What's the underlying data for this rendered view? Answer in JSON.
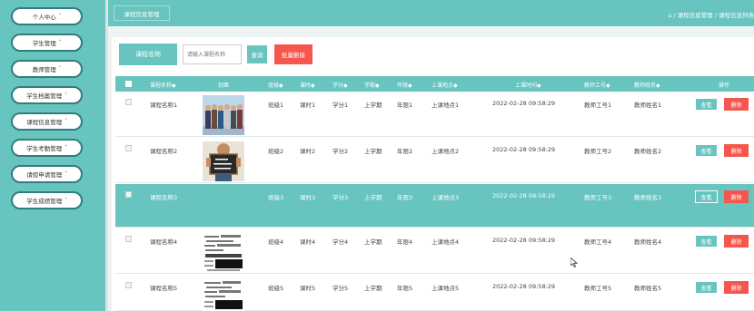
{
  "sidebar": {
    "items": [
      {
        "label": "个人中心"
      },
      {
        "label": "学生管理"
      },
      {
        "label": "教师管理"
      },
      {
        "label": "学生档案管理"
      },
      {
        "label": "课程信息管理"
      },
      {
        "label": "学生考勤管理"
      },
      {
        "label": "请假申请管理"
      },
      {
        "label": "学生成绩管理"
      }
    ],
    "caret": "˅"
  },
  "topbar": {
    "module_tab": "课程信息管理",
    "breadcrumb": "⌂ / 课程信息管理 / 课程信息列表"
  },
  "search": {
    "label": "课程名称",
    "placeholder": "请输入课程名称",
    "query_button": "查询",
    "batch_delete_button": "批量删除"
  },
  "table": {
    "headers": [
      "课程名称◆",
      "封面",
      "班级◆",
      "课时◆",
      "学分◆",
      "学期◆",
      "年限◆",
      "上课地点◆",
      "上课时间◆",
      "教师工号◆",
      "教师姓名◆",
      "操作"
    ],
    "rows": [
      {
        "name": "课程名称1",
        "class": "班级1",
        "hours": "课时1",
        "credit": "学分1",
        "term": "上学期",
        "years": "年限1",
        "location": "上课地点1",
        "time": "2022-02-28 09:58:29",
        "tno": "教师工号1",
        "tname": "教师姓名1"
      },
      {
        "name": "课程名称2",
        "class": "班级2",
        "hours": "课时2",
        "credit": "学分2",
        "term": "上学期",
        "years": "年限2",
        "location": "上课地点2",
        "time": "2022-02-28 09:58:29",
        "tno": "教师工号2",
        "tname": "教师姓名2"
      },
      {
        "name": "课程名称3",
        "class": "班级3",
        "hours": "课时3",
        "credit": "学分3",
        "term": "上学期",
        "years": "年限3",
        "location": "上课地点3",
        "time": "2022-02-28 09:58:29",
        "tno": "教师工号3",
        "tname": "教师姓名3"
      },
      {
        "name": "课程名称4",
        "class": "班级4",
        "hours": "课时4",
        "credit": "学分4",
        "term": "上学期",
        "years": "年限4",
        "location": "上课地点4",
        "time": "2022-02-28 09:58:29",
        "tno": "教师工号4",
        "tname": "教师姓名4"
      },
      {
        "name": "课程名称5",
        "class": "班级5",
        "hours": "课时5",
        "credit": "学分5",
        "term": "上学期",
        "years": "年限5",
        "location": "上课地点5",
        "time": "2022-02-28 09:58:29",
        "tno": "教师工号5",
        "tname": "教师姓名5"
      }
    ],
    "view_label": "查看",
    "delete_label": "删除"
  },
  "colors": {
    "accent": "#67c4bf",
    "danger": "#f4574d"
  },
  "icons": {
    "cursor": "mouse-pointer-icon"
  }
}
